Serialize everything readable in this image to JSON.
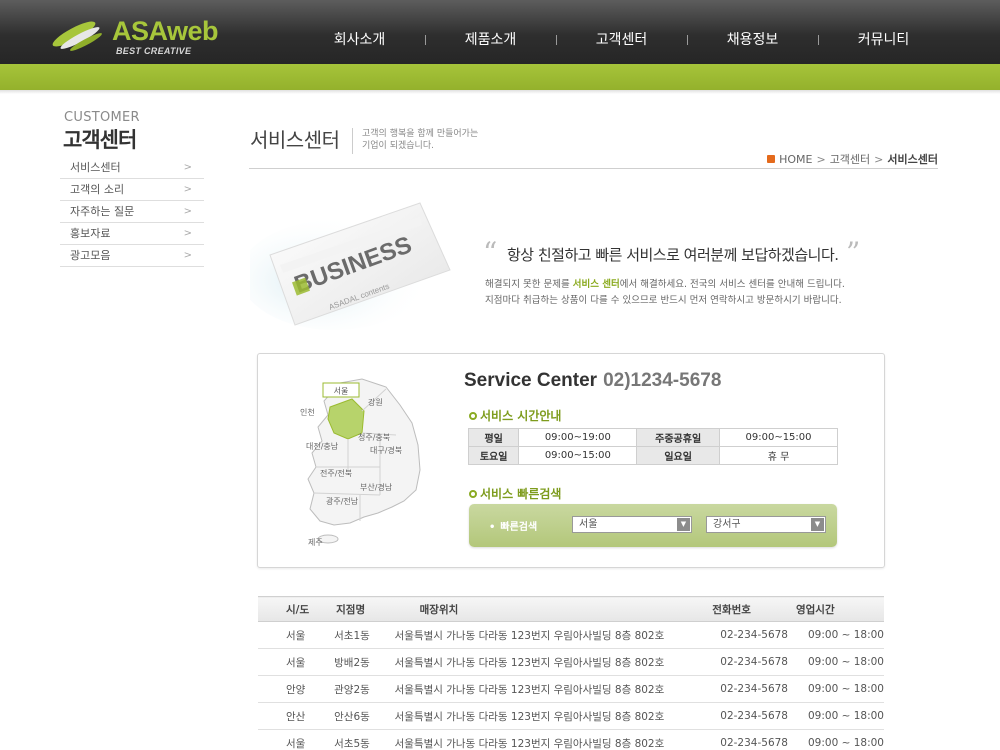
{
  "brand": {
    "name_a": "ASA",
    "name_b": "web",
    "tagline": "BEST CREATIVE"
  },
  "gnb": [
    "회사소개",
    "제품소개",
    "고객센터",
    "채용정보",
    "커뮤니티"
  ],
  "lnb": {
    "title_en": "CUSTOMER",
    "title_ko": "고객센터",
    "items": [
      {
        "label": "서비스센터",
        "arrow": ">"
      },
      {
        "label": "고객의 소리",
        "arrow": ">"
      },
      {
        "label": "자주하는 질문",
        "arrow": ">"
      },
      {
        "label": "홍보자료",
        "arrow": ">"
      },
      {
        "label": "광고모음",
        "arrow": ">"
      }
    ]
  },
  "page": {
    "title": "서비스센터",
    "desc_line1": "고객의 행복을 함께 만들어가는",
    "desc_line2": "기업이 되겠습니다.",
    "breadcrumb": {
      "home": "HOME",
      "sep": ">",
      "parent": "고객센터",
      "current": "서비스센터"
    }
  },
  "card_visual": {
    "word": "BUSINESS",
    "sub": "ASADAL contents"
  },
  "quote": {
    "open": "“",
    "close": "”",
    "text": "항상 친절하고 빠른 서비스로 여러분께 보답하겠습니다.",
    "sub1_pre": "해결되지 못한 문제를 ",
    "sub1_hl": "서비스 센터",
    "sub1_post": "에서 해결하세요. 전국의 서비스 센터를 안내해 드립니다.",
    "sub2": "지점마다 취급하는 상품이 다를 수 있으므로 반드시 먼저 연락하시고 방문하시기 바랍니다."
  },
  "service": {
    "title": "Service Center",
    "phone": "02)1234-5678",
    "hours_title": "서비스 시간안내",
    "hours": [
      [
        "평일",
        "09:00~19:00",
        "주중공휴일",
        "09:00~15:00"
      ],
      [
        "토요일",
        "09:00~15:00",
        "일요일",
        "휴  무"
      ]
    ],
    "search_title": "서비스 빠른검색",
    "search_label": "빠른검색",
    "select1": "서울",
    "select2": "강서구",
    "dropdown_glyph": "▼"
  },
  "map_labels": {
    "seoul": "서울",
    "incheon": "인천",
    "gangwon": "강원",
    "chungju": "청주/충북",
    "daejeon": "대전/충남",
    "daegu": "대구/경북",
    "jeonju": "전주/전북",
    "busan": "부산/경남",
    "gwangju": "광주/전남",
    "jeju": "제주"
  },
  "table": {
    "headers": [
      "시/도",
      "지점명",
      "매장위치",
      "전화번호",
      "영업시간"
    ],
    "rows": [
      [
        "서울",
        "서초1동",
        "서울특별시 가나동 다라동 123번지 우림아사빌딩 8층 802호",
        "02-234-5678",
        "09:00 ~ 18:00"
      ],
      [
        "서울",
        "방배2동",
        "서울특별시 가나동 다라동 123번지 우림아사빌딩 8층 802호",
        "02-234-5678",
        "09:00 ~ 18:00"
      ],
      [
        "안양",
        "관양2동",
        "서울특별시 가나동 다라동 123번지 우림아사빌딩 8층 802호",
        "02-234-5678",
        "09:00 ~ 18:00"
      ],
      [
        "안산",
        "안산6동",
        "서울특별시 가나동 다라동 123번지 우림아사빌딩 8층 802호",
        "02-234-5678",
        "09:00 ~ 18:00"
      ],
      [
        "서울",
        "서초5동",
        "서울특별시 가나동 다라동 123번지 우림아사빌딩 8층 802호",
        "02-234-5678",
        "09:00 ~ 18:00"
      ]
    ]
  },
  "colors": {
    "accent": "#9bbb30",
    "header_dark": "#2e2e2e",
    "map_highlight": "#b7d36b"
  }
}
